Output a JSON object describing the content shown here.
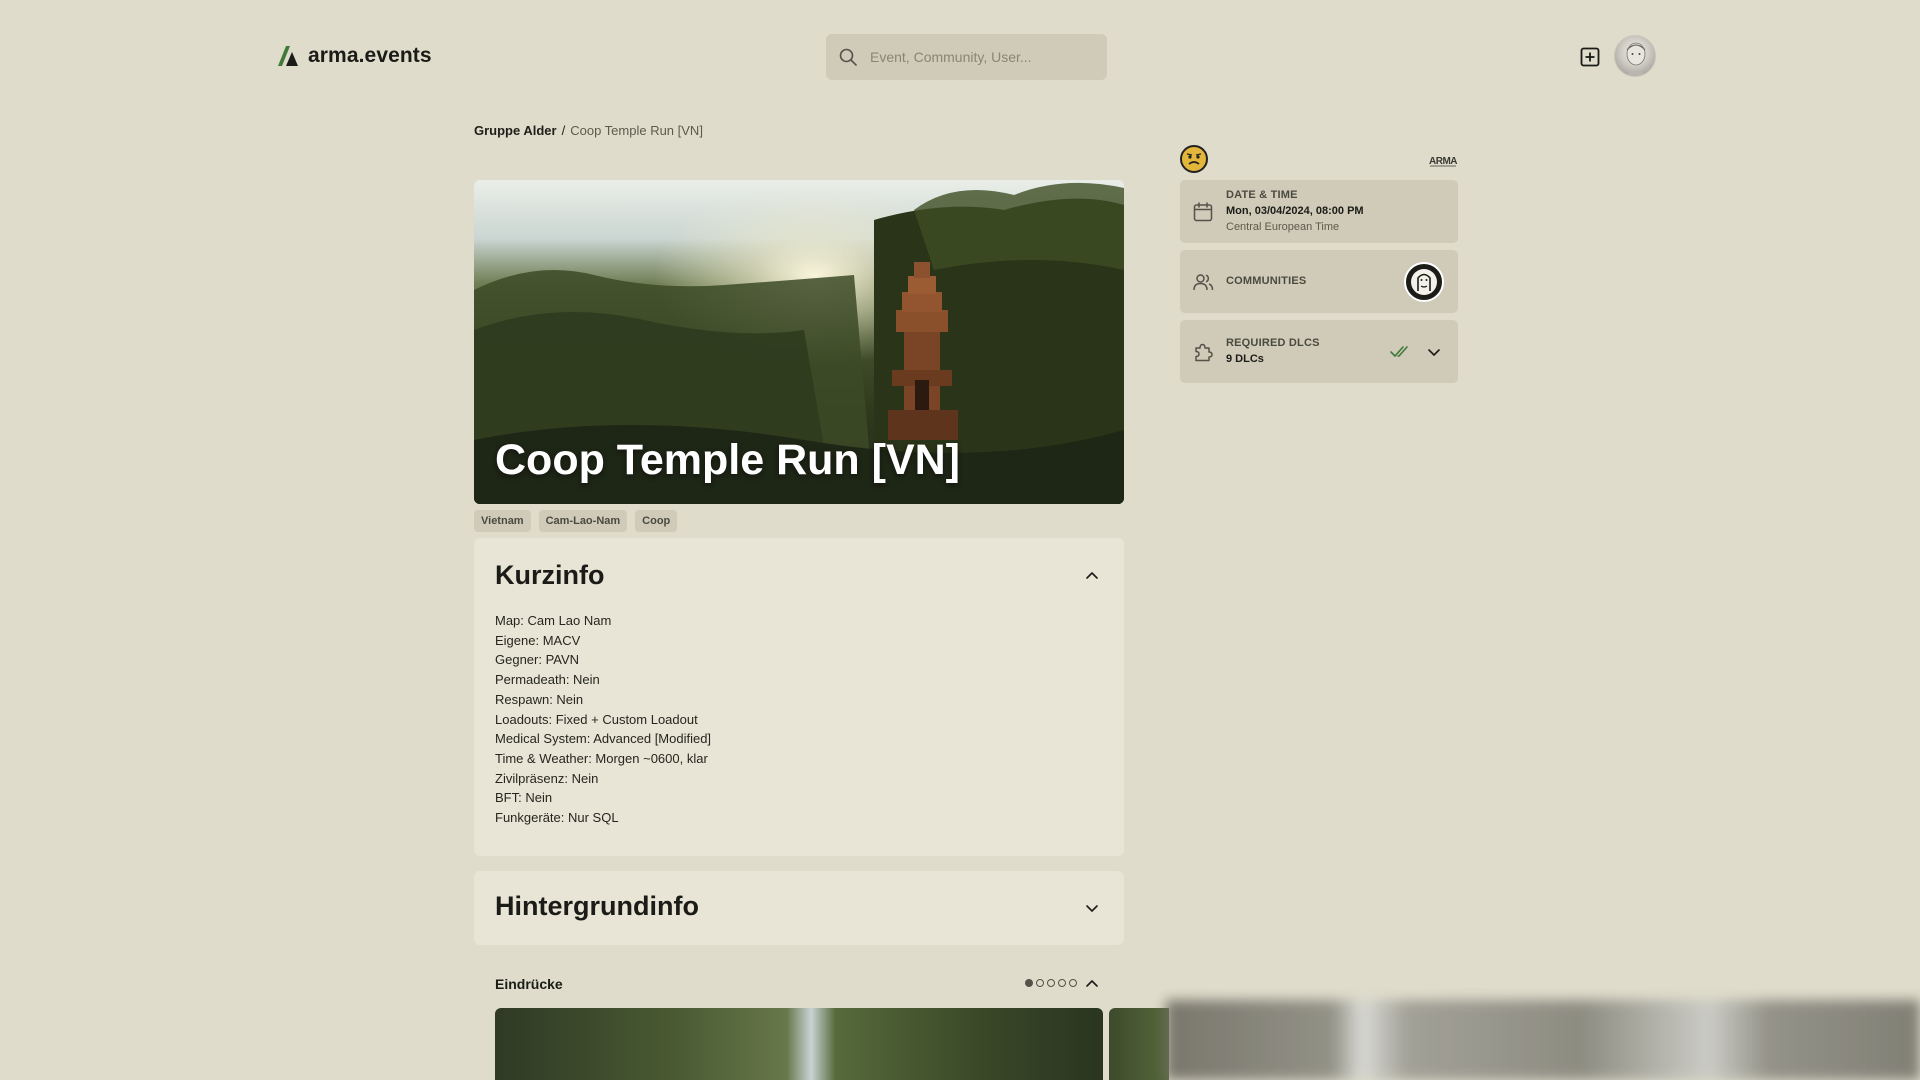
{
  "header": {
    "logo_text": "arma.events",
    "search_placeholder": "Event, Community, User..."
  },
  "breadcrumb": {
    "group": "Gruppe Alder",
    "separator": "/",
    "current": "Coop Temple Run [VN]"
  },
  "event": {
    "title": "Coop Temple Run [VN]",
    "tags": [
      "Vietnam",
      "Cam-Lao-Nam",
      "Coop"
    ]
  },
  "kurzinfo": {
    "title": "Kurzinfo",
    "items": [
      "Map: Cam Lao Nam",
      "Eigene: MACV",
      "Gegner: PAVN",
      "Permadeath: Nein",
      "Respawn: Nein",
      "Loadouts: Fixed + Custom Loadout",
      "Medical System: Advanced [Modified]",
      "Time & Weather: Morgen ~0600, klar",
      "Zivilpräsenz: Nein",
      "BFT: Nein",
      "Funkgeräte: Nur SQL"
    ]
  },
  "hintergrundinfo": {
    "title": "Hintergrundinfo"
  },
  "eindruecke": {
    "title": "Eindrücke",
    "slide_count": 5,
    "active_slide": 0
  },
  "sidebar": {
    "datetime": {
      "label": "DATE & TIME",
      "value": "Mon, 03/04/2024, 08:00 PM",
      "timezone": "Central European Time"
    },
    "communities": {
      "label": "COMMUNITIES"
    },
    "dlcs": {
      "label": "REQUIRED DLCS",
      "value": "9 DLCs"
    }
  },
  "colors": {
    "background": "#dfdccb",
    "card": "#e8e5d6",
    "sidebar_card": "#cfcbb8",
    "accent_green": "#3f7a3a",
    "text": "#1b1b17"
  }
}
